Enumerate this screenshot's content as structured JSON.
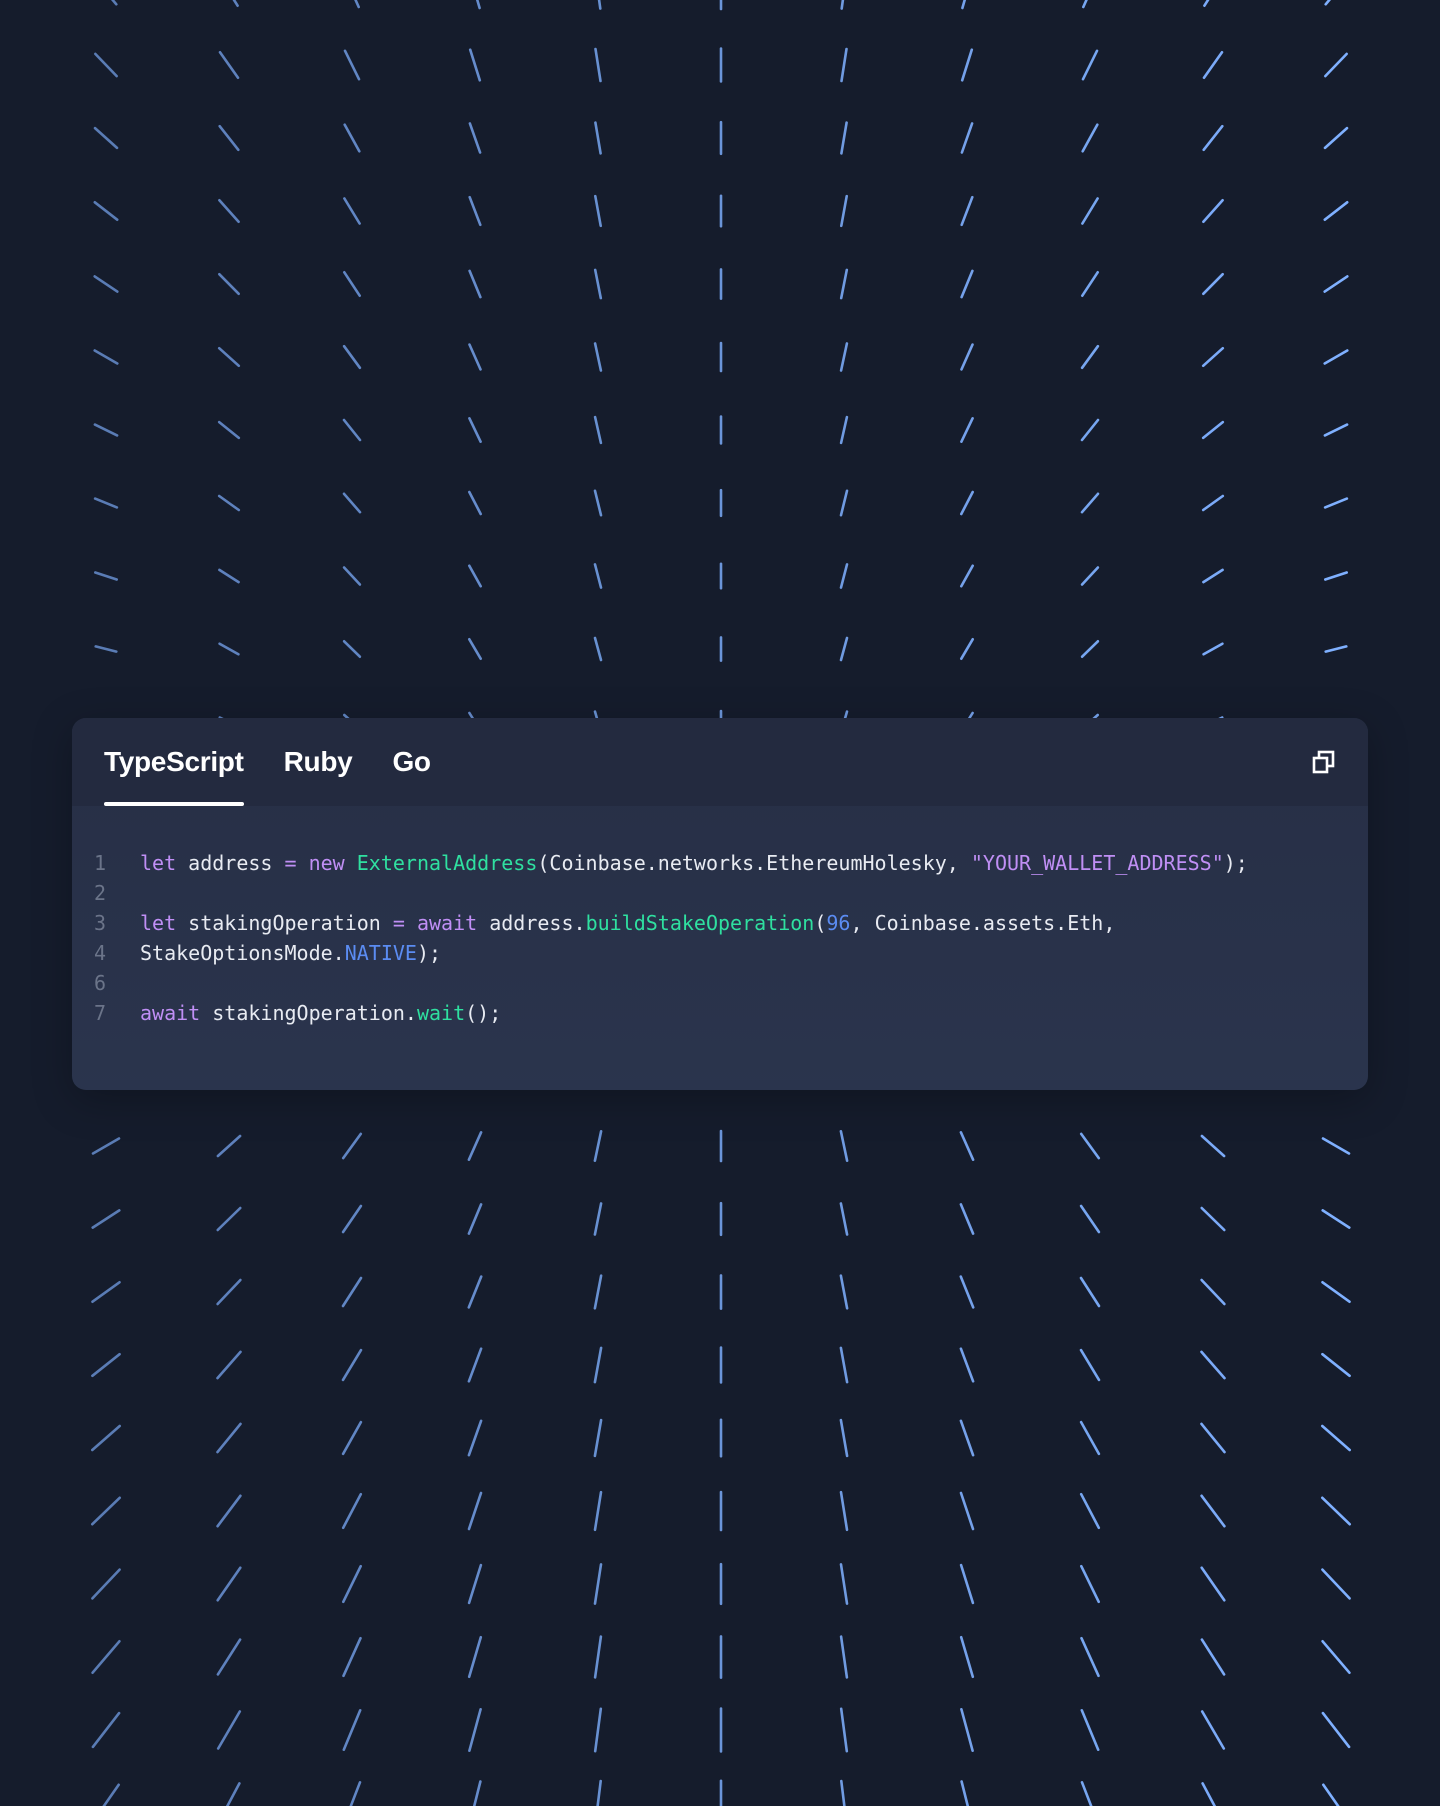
{
  "tabs": [
    {
      "label": "TypeScript",
      "active": true
    },
    {
      "label": "Ruby",
      "active": false
    },
    {
      "label": "Go",
      "active": false
    }
  ],
  "copy_button": {
    "icon": "copy-icon"
  },
  "colors": {
    "background": "#151c2c",
    "line_stroke": "#7fb0ff",
    "keyword": "#c08ff5",
    "function": "#2fe0a0",
    "number": "#5b8cf2",
    "text": "#e8ebf2",
    "line_number": "#6b7489"
  },
  "code": {
    "language": "TypeScript",
    "lines": [
      {
        "number": "1",
        "tokens": [
          {
            "t": "let",
            "k": "kw"
          },
          {
            "t": " address ",
            "k": "txt"
          },
          {
            "t": "=",
            "k": "kw"
          },
          {
            "t": " ",
            "k": "txt"
          },
          {
            "t": "new",
            "k": "kw"
          },
          {
            "t": " ",
            "k": "txt"
          },
          {
            "t": "ExternalAddress",
            "k": "fn"
          },
          {
            "t": "(Coinbase.networks.EthereumHolesky, ",
            "k": "txt"
          },
          {
            "t": "\"YOUR_WALLET_ADDRESS\"",
            "k": "str"
          },
          {
            "t": ");",
            "k": "txt"
          }
        ]
      },
      {
        "number": "2",
        "tokens": []
      },
      {
        "number": "3",
        "tokens": [
          {
            "t": "let",
            "k": "kw"
          },
          {
            "t": " stakingOperation ",
            "k": "txt"
          },
          {
            "t": "=",
            "k": "kw"
          },
          {
            "t": " ",
            "k": "txt"
          },
          {
            "t": "await",
            "k": "kw"
          },
          {
            "t": " address.",
            "k": "txt"
          },
          {
            "t": "buildStakeOperation",
            "k": "fn"
          },
          {
            "t": "(",
            "k": "txt"
          },
          {
            "t": "96",
            "k": "num"
          },
          {
            "t": ", Coinbase.assets.Eth,",
            "k": "txt"
          }
        ]
      },
      {
        "number": "4",
        "tokens": [
          {
            "t": "StakeOptionsMode.",
            "k": "txt"
          },
          {
            "t": "NATIVE",
            "k": "const"
          },
          {
            "t": ");",
            "k": "txt"
          }
        ]
      },
      {
        "number": "6",
        "tokens": []
      },
      {
        "number": "7",
        "tokens": [
          {
            "t": "await",
            "k": "kw"
          },
          {
            "t": " stakingOperation.",
            "k": "txt"
          },
          {
            "t": "wait",
            "k": "fn"
          },
          {
            "t": "();",
            "k": "txt"
          }
        ]
      }
    ]
  }
}
